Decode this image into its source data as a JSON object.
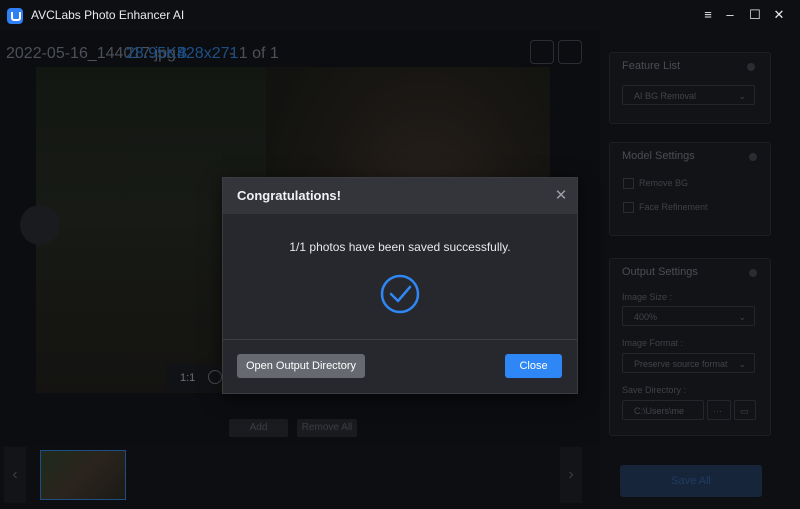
{
  "window": {
    "title": "AVCLabs Photo Enhancer AI",
    "controls": [
      "≡",
      "–",
      "☐",
      "✕"
    ]
  },
  "viewer": {
    "filename": "2022-05-16_144017.jpg",
    "filesize": "28.95KB",
    "dimensions": "428x271",
    "page_info": "- 1 of 1",
    "zoom": "1:1"
  },
  "bottom": {
    "add_label": "Add",
    "remove_all_label": "Remove All"
  },
  "right_panel": {
    "feature_list_title": "Feature List",
    "feature_selected": "AI BG Removal",
    "model_settings_title": "Model Settings",
    "option_remove_bg": "Remove BG",
    "option_face_refinement": "Face Refinement",
    "output_settings_title": "Output Settings",
    "image_size_label": "Image Size :",
    "image_size_value": "400%",
    "image_format_label": "Image Format :",
    "image_format_value": "Preserve source format",
    "save_directory_label": "Save Directory :",
    "save_directory_value": "C:\\Users\\me",
    "browse_dots": "···",
    "save_all_label": "Save All"
  },
  "dialog": {
    "title": "Congratulations!",
    "message": "1/1 photos have been saved successfully.",
    "open_output_label": "Open Output Directory",
    "close_label": "Close"
  },
  "colors": {
    "accent": "#2f87f5",
    "dialog_bg": "#26282e",
    "secondary_button": "#666970"
  },
  "icons": {
    "app_logo": "app-logo-icon",
    "success_check": "check-circle-icon",
    "dialog_close": "close-icon"
  }
}
